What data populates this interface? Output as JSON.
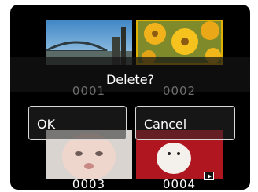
{
  "dialog": {
    "prompt": "Delete?",
    "ok_label": "OK",
    "cancel_label": "Cancel"
  },
  "thumbnails": [
    {
      "number": "0001",
      "subject": "harbour bridge"
    },
    {
      "number": "0002",
      "subject": "yellow flowers",
      "selected": true
    },
    {
      "number": "0003",
      "subject": "baby"
    },
    {
      "number": "0004",
      "subject": "toy on red",
      "type": "movie"
    }
  ],
  "colors": {
    "selection_border": "#e0b000",
    "screen_background": "#000000",
    "button_border": "#d8d8d8"
  }
}
